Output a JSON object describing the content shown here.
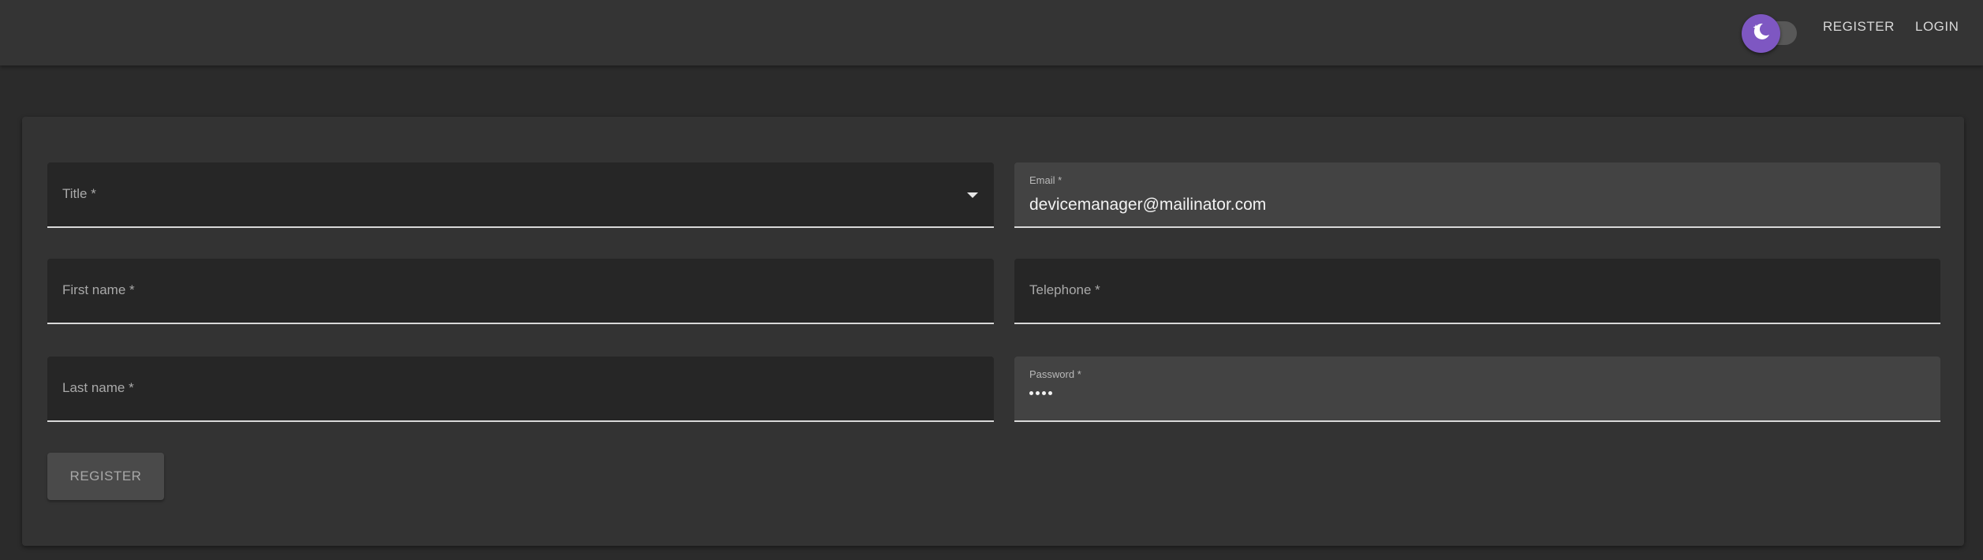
{
  "header": {
    "theme_toggle": {
      "icon": "moon-icon",
      "state": "dark",
      "accent": "#7e57c2"
    },
    "nav": [
      {
        "label": "REGISTER"
      },
      {
        "label": "LOGIN"
      }
    ]
  },
  "form": {
    "title_field": {
      "label": "Title *",
      "value": ""
    },
    "first_name": {
      "label": "First name *",
      "value": ""
    },
    "last_name": {
      "label": "Last name *",
      "value": ""
    },
    "email": {
      "label": "Email *",
      "value": "devicemanager@mailinator.com"
    },
    "telephone": {
      "label": "Telephone *",
      "value": ""
    },
    "password": {
      "label": "Password *",
      "masked_length": 4
    },
    "submit_label": "REGISTER"
  }
}
